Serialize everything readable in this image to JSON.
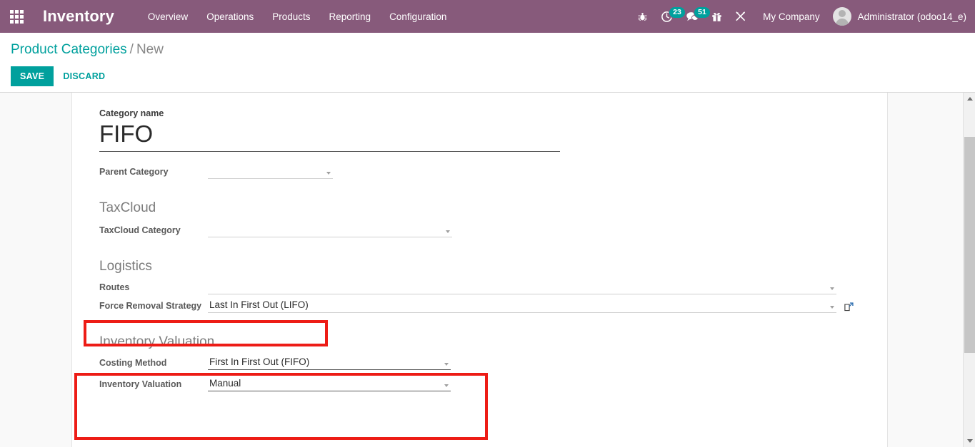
{
  "navbar": {
    "apps_icon": "apps-grid-icon",
    "brand": "Inventory",
    "menu": [
      {
        "label": "Overview"
      },
      {
        "label": "Operations"
      },
      {
        "label": "Products"
      },
      {
        "label": "Reporting"
      },
      {
        "label": "Configuration"
      }
    ],
    "icons": [
      {
        "name": "bug-icon",
        "badge": null
      },
      {
        "name": "activity-clock-icon",
        "badge": "23"
      },
      {
        "name": "messages-chat-icon",
        "badge": "51"
      },
      {
        "name": "gift-icon",
        "badge": null
      },
      {
        "name": "developer-tools-icon",
        "badge": null
      }
    ],
    "company": "My Company",
    "user": "Administrator (odoo14_e)",
    "background_color": "#875A7B",
    "badge_color": "#00A09D"
  },
  "control_panel": {
    "breadcrumb": {
      "root": "Product Categories",
      "separator": "/",
      "current": "New"
    },
    "save_label": "SAVE",
    "discard_label": "DISCARD",
    "accent_color": "#00A09D"
  },
  "form": {
    "title_field": {
      "label": "Category name",
      "value": "FIFO"
    },
    "parent_category": {
      "label": "Parent Category",
      "value": "",
      "placeholder": ""
    },
    "taxcloud": {
      "section_title": "TaxCloud",
      "category": {
        "label": "TaxCloud Category",
        "value": "",
        "placeholder": ""
      }
    },
    "logistics": {
      "section_title": "Logistics",
      "routes": {
        "label": "Routes",
        "value": "",
        "placeholder": ""
      },
      "force_removal_strategy": {
        "label": "Force Removal Strategy",
        "value": "Last In First Out (LIFO)",
        "external_link_icon": "external-link-icon"
      }
    },
    "inventory_valuation": {
      "section_title": "Inventory Valuation",
      "costing_method": {
        "label": "Costing Method",
        "value": "First In First Out (FIFO)"
      },
      "valuation": {
        "label": "Inventory Valuation",
        "value": "Manual"
      }
    }
  },
  "annotations": {
    "highlight_color": "#ED1C16",
    "boxes": [
      {
        "name": "force-removal-strategy-highlight"
      },
      {
        "name": "inventory-valuation-highlight"
      }
    ]
  },
  "scrollbar": {
    "up_arrow": "scroll-up-icon",
    "down_arrow": "scroll-down-icon"
  }
}
